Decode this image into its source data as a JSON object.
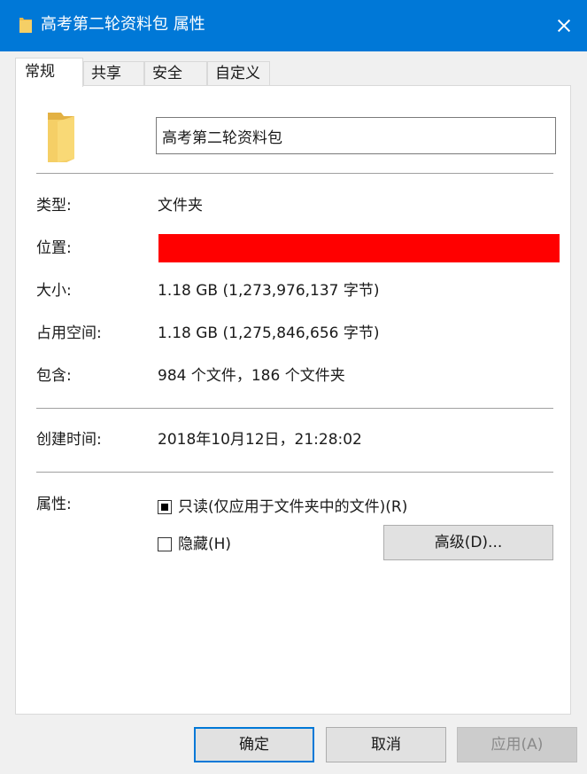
{
  "window": {
    "title": "高考第二轮资料包 属性",
    "folder_icon": "folder-icon",
    "close_icon": "close-icon"
  },
  "tabs": [
    {
      "label": "常规",
      "active": true
    },
    {
      "label": "共享",
      "active": false
    },
    {
      "label": "安全",
      "active": false
    },
    {
      "label": "自定义",
      "active": false
    }
  ],
  "general": {
    "folder_name": "高考第二轮资料包",
    "type_label": "类型:",
    "type_value": "文件夹",
    "location_label": "位置:",
    "location_redacted_color": "#ff0000",
    "size_label": "大小:",
    "size_value": "1.18 GB (1,273,976,137 字节)",
    "disk_size_label": "占用空间:",
    "disk_size_value": "1.18 GB (1,275,846,656 字节)",
    "contains_label": "包含:",
    "contains_value": "984 个文件，186 个文件夹",
    "created_label": "创建时间:",
    "created_value": "2018年10月12日，21:28:02",
    "attributes_label": "属性:",
    "readonly_label": "只读(仅应用于文件夹中的文件)(R)",
    "readonly_state": "indeterminate",
    "hidden_label": "隐藏(H)",
    "hidden_checked": false,
    "advanced_button": "高级(D)..."
  },
  "footer": {
    "ok": "确定",
    "cancel": "取消",
    "apply": "应用(A)",
    "apply_enabled": false
  },
  "colors": {
    "titlebar": "#0078d7",
    "dialog_bg": "#f0f0f0",
    "panel_bg": "#ffffff",
    "default_button_border": "#0078d7"
  }
}
